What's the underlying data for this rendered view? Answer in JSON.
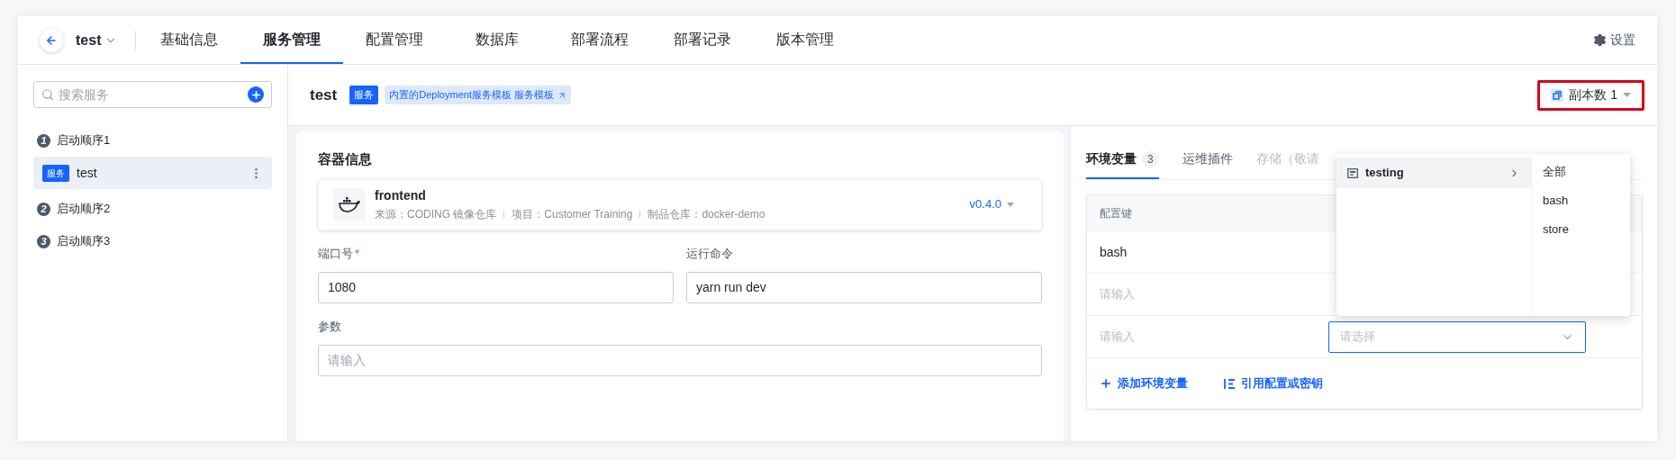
{
  "top_nav": {
    "project": "test",
    "tabs": [
      {
        "label": "基础信息",
        "selected": false
      },
      {
        "label": "服务管理",
        "selected": true
      },
      {
        "label": "配置管理",
        "selected": false
      },
      {
        "label": "数据库",
        "selected": false
      },
      {
        "label": "部署流程",
        "selected": false
      },
      {
        "label": "部署记录",
        "selected": false
      },
      {
        "label": "版本管理",
        "selected": false
      }
    ],
    "settings": "设置"
  },
  "sidebar": {
    "search_placeholder": "搜索服务",
    "groups": [
      {
        "index": "1",
        "label": "启动顺序1",
        "services": [
          {
            "badge": "服务",
            "name": "test",
            "selected": true
          }
        ]
      },
      {
        "index": "2",
        "label": "启动顺序2"
      },
      {
        "index": "3",
        "label": "启动顺序3"
      }
    ]
  },
  "header": {
    "title": "test",
    "badge": "服务",
    "template_link": "内置的Deployment服务模板 服务模板",
    "replicas": "副本数 1",
    "highlighted": true
  },
  "container": {
    "title": "容器信息",
    "image": {
      "name": "frontend",
      "meta": [
        "来源：CODING 镜像仓库",
        "项目：Customer Training",
        "制品仓库：docker-demo"
      ],
      "version": "v0.4.0"
    },
    "fields": [
      {
        "label": "端口号",
        "required_mark": "*",
        "value": "1080"
      },
      {
        "label": "运行命令",
        "value": "yarn run dev"
      },
      {
        "label": "参数",
        "placeholder": "请输入"
      }
    ]
  },
  "env_panel": {
    "tabs": [
      {
        "label": "环境变量",
        "count": "3",
        "selected": true,
        "disabled": false
      },
      {
        "label": "运维插件",
        "selected": false,
        "disabled": false
      },
      {
        "label": "存储（敬请",
        "selected": false,
        "disabled": true
      }
    ],
    "table": {
      "columns": [
        "配置键"
      ],
      "rows": [
        {
          "key": "bash"
        },
        {
          "key_placeholder": "请输入"
        },
        {
          "key_placeholder": "请输入",
          "select_placeholder": "请选择",
          "focused": true
        }
      ]
    },
    "actions": [
      {
        "kind": "add",
        "label": "添加环境变量"
      },
      {
        "kind": "reference",
        "label": "引用配置或密钥"
      }
    ]
  },
  "dropdown": {
    "groups": [
      {
        "label": "testing",
        "selected": true
      }
    ],
    "options": [
      "全部",
      "bash",
      "store"
    ]
  }
}
